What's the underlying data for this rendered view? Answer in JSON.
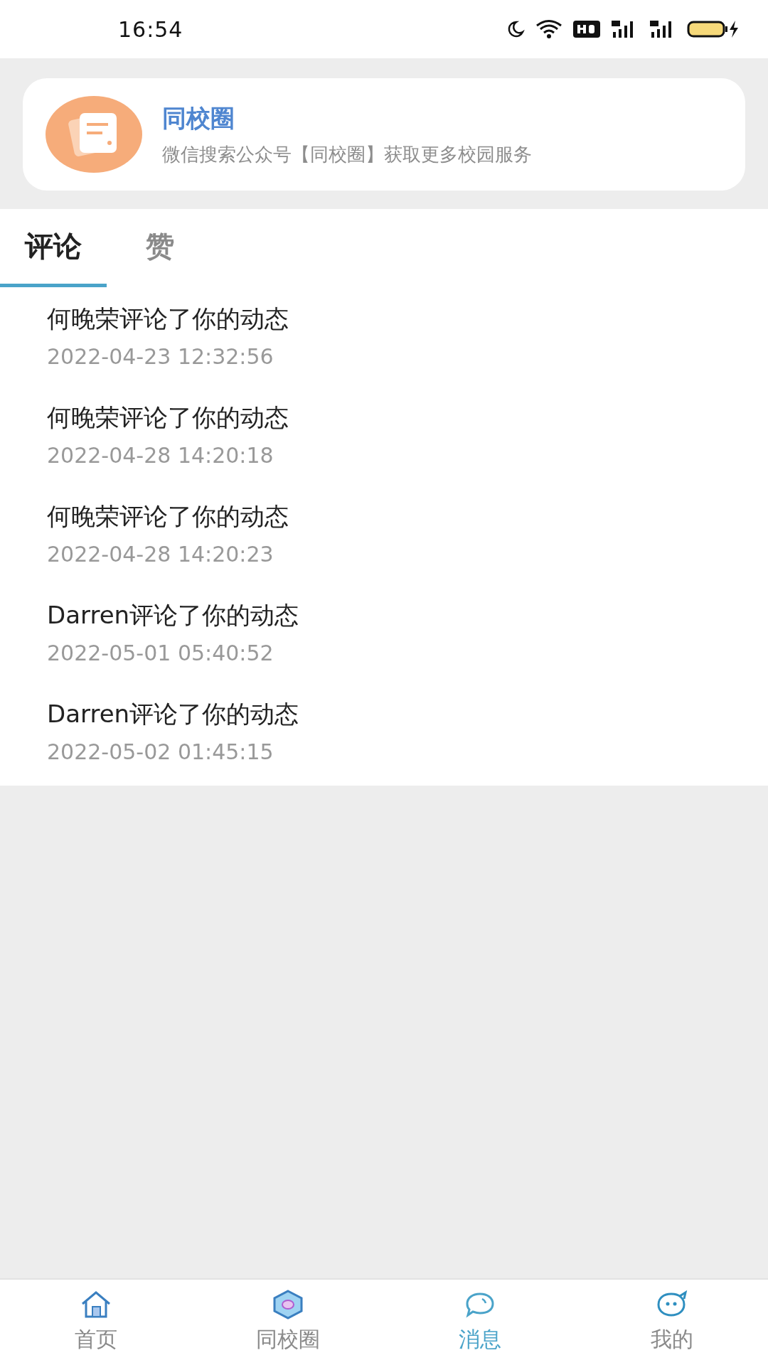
{
  "status_bar": {
    "time": "16:54"
  },
  "banner": {
    "title": "同校圈",
    "subtitle": "微信搜索公众号【同校圈】获取更多校园服务"
  },
  "tabs": [
    {
      "label": "评论",
      "selected": true
    },
    {
      "label": "赞",
      "selected": false
    }
  ],
  "notifications": [
    {
      "text": "何晚荣评论了你的动态",
      "time": "2022-04-23 12:32:56"
    },
    {
      "text": "何晚荣评论了你的动态",
      "time": "2022-04-28 14:20:18"
    },
    {
      "text": "何晚荣评论了你的动态",
      "time": "2022-04-28 14:20:23"
    },
    {
      "text": "Darren评论了你的动态",
      "time": "2022-05-01 05:40:52"
    },
    {
      "text": "Darren评论了你的动态",
      "time": "2022-05-02 01:45:15"
    }
  ],
  "bottom_nav": [
    {
      "label": "首页",
      "kind": "home",
      "selected": false
    },
    {
      "label": "同校圈",
      "kind": "circle",
      "selected": false
    },
    {
      "label": "消息",
      "kind": "message",
      "selected": true
    },
    {
      "label": "我的",
      "kind": "profile",
      "selected": false
    }
  ]
}
